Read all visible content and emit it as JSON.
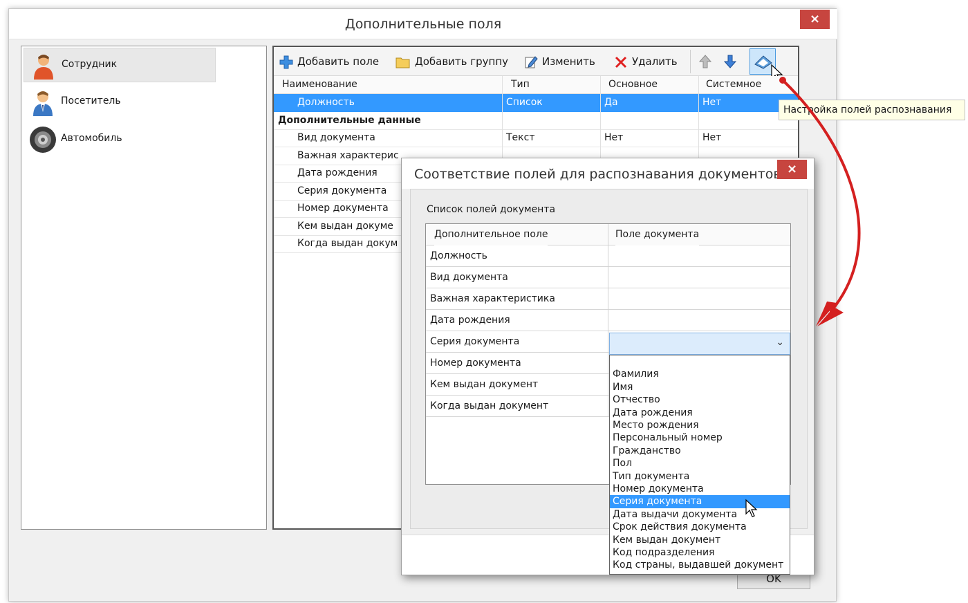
{
  "main_window": {
    "title": "Дополнительные поля",
    "close_label": "×",
    "ok_label": "OK"
  },
  "categories": [
    {
      "label": "Сотрудник",
      "icon": "employee-icon",
      "selected": true
    },
    {
      "label": "Посетитель",
      "icon": "visitor-icon",
      "selected": false
    },
    {
      "label": "Автомобиль",
      "icon": "car-wheel-icon",
      "selected": false
    }
  ],
  "toolbar": {
    "add_field": "Добавить поле",
    "add_group": "Добавить группу",
    "edit": "Изменить",
    "delete": "Удалить",
    "tooltip": "Настройка полей распознавания"
  },
  "grid": {
    "columns": [
      "Наименование",
      "Тип",
      "Основное",
      "Системное"
    ],
    "rows": [
      {
        "name": "Должность",
        "type": "Список",
        "main": "Да",
        "system": "Нет",
        "selected": true
      },
      {
        "group": "Дополнительные данные"
      },
      {
        "name": "Вид документа",
        "type": "Текст",
        "main": "Нет",
        "system": "Нет"
      },
      {
        "name": "Важная характерис",
        "type": "",
        "main": "",
        "system": ""
      },
      {
        "name": "Дата рождения",
        "type": "",
        "main": "",
        "system": ""
      },
      {
        "name": "Серия документа",
        "type": "",
        "main": "",
        "system": ""
      },
      {
        "name": "Номер документа",
        "type": "",
        "main": "",
        "system": ""
      },
      {
        "name": "Кем выдан докуме",
        "type": "",
        "main": "",
        "system": ""
      },
      {
        "name": "Когда выдан докум",
        "type": "",
        "main": "",
        "system": ""
      }
    ]
  },
  "dialog": {
    "title": "Соответствие полей для распознавания документов",
    "close_label": "×",
    "list_caption": "Список полей документа",
    "columns": [
      "Дополнительное поле",
      "Поле документа"
    ],
    "rows": [
      "Должность",
      "Вид документа",
      "Важная характеристика",
      "Дата рождения",
      "Серия документа",
      "Номер документа",
      "Кем выдан документ",
      "Когда выдан документ"
    ],
    "combo_value": "",
    "dropdown_options": [
      "",
      "Фамилия",
      "Имя",
      "Отчество",
      "Дата рождения",
      "Место рождения",
      "Персональный номер",
      "Гражданство",
      "Пол",
      "Тип документа",
      "Номер документа",
      "Серия документа",
      "Дата выдачи документа",
      "Срок действия документа",
      "Кем выдан документ",
      "Код подразделения",
      "Код страны, выдавшей документ"
    ],
    "highlighted_option": "Серия документа"
  },
  "colors": {
    "selection": "#3399ff",
    "close_button": "#c7453f",
    "annotation_arrow": "#d42020"
  }
}
